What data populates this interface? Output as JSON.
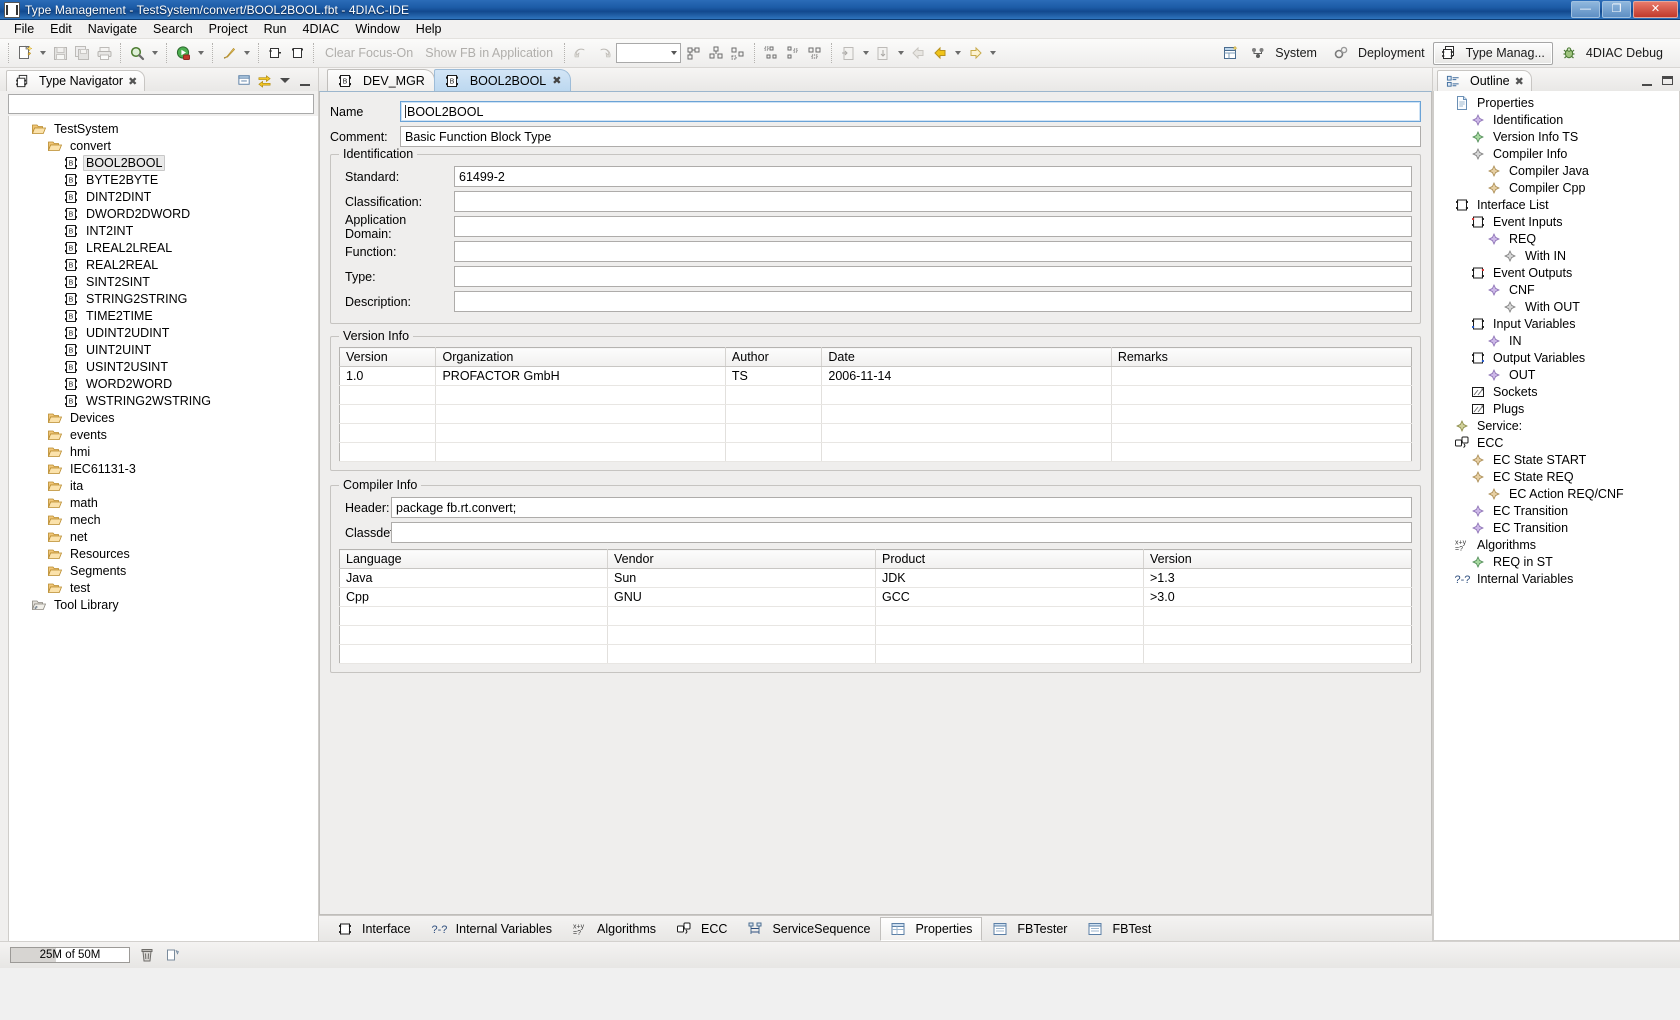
{
  "window": {
    "title": "Type Management - TestSystem/convert/BOOL2BOOL.fbt - 4DIAC-IDE",
    "minimize_label": "—",
    "maximize_label": "❐",
    "close_label": "✕"
  },
  "menubar": {
    "items": [
      "File",
      "Edit",
      "Navigate",
      "Search",
      "Project",
      "Run",
      "4DIAC",
      "Window",
      "Help"
    ]
  },
  "toolbar": {
    "clear_focus_label": "Clear Focus-On",
    "show_fb_label": "Show FB in Application",
    "combo_value": "",
    "perspectives": [
      {
        "label": "System",
        "icon": "system-icon",
        "active": false
      },
      {
        "label": "Deployment",
        "icon": "deployment-icon",
        "active": false
      },
      {
        "label": "Type Manag...",
        "icon": "type-management-icon",
        "active": true
      },
      {
        "label": "4DIAC Debug",
        "icon": "debug-icon",
        "active": false
      }
    ]
  },
  "navigator": {
    "tab_label": "Type Navigator",
    "close_icon": "close-icon",
    "tools": [
      "link-with-editor-icon",
      "synchronize-icon",
      "view-menu-icon",
      "minimize-icon"
    ],
    "filter_value": "",
    "tree": [
      {
        "label": "TestSystem",
        "icon": "folder-open-icon",
        "indent": 1,
        "selected": false
      },
      {
        "label": "convert",
        "icon": "folder-open-icon",
        "indent": 2,
        "selected": false
      },
      {
        "label": "BOOL2BOOL",
        "icon": "fb-type-icon",
        "indent": 3,
        "selected": true
      },
      {
        "label": "BYTE2BYTE",
        "icon": "fb-type-icon",
        "indent": 3,
        "selected": false
      },
      {
        "label": "DINT2DINT",
        "icon": "fb-type-icon",
        "indent": 3,
        "selected": false
      },
      {
        "label": "DWORD2DWORD",
        "icon": "fb-type-icon",
        "indent": 3,
        "selected": false
      },
      {
        "label": "INT2INT",
        "icon": "fb-type-icon",
        "indent": 3,
        "selected": false
      },
      {
        "label": "LREAL2LREAL",
        "icon": "fb-type-icon",
        "indent": 3,
        "selected": false
      },
      {
        "label": "REAL2REAL",
        "icon": "fb-type-icon",
        "indent": 3,
        "selected": false
      },
      {
        "label": "SINT2SINT",
        "icon": "fb-type-icon",
        "indent": 3,
        "selected": false
      },
      {
        "label": "STRING2STRING",
        "icon": "fb-type-icon",
        "indent": 3,
        "selected": false
      },
      {
        "label": "TIME2TIME",
        "icon": "fb-type-icon",
        "indent": 3,
        "selected": false
      },
      {
        "label": "UDINT2UDINT",
        "icon": "fb-type-icon",
        "indent": 3,
        "selected": false
      },
      {
        "label": "UINT2UINT",
        "icon": "fb-type-icon",
        "indent": 3,
        "selected": false
      },
      {
        "label": "USINT2USINT",
        "icon": "fb-type-icon",
        "indent": 3,
        "selected": false
      },
      {
        "label": "WORD2WORD",
        "icon": "fb-type-icon",
        "indent": 3,
        "selected": false
      },
      {
        "label": "WSTRING2WSTRING",
        "icon": "fb-type-icon",
        "indent": 3,
        "selected": false
      },
      {
        "label": "Devices",
        "icon": "folder-open-icon",
        "indent": 2,
        "selected": false
      },
      {
        "label": "events",
        "icon": "folder-open-icon",
        "indent": 2,
        "selected": false
      },
      {
        "label": "hmi",
        "icon": "folder-open-icon",
        "indent": 2,
        "selected": false
      },
      {
        "label": "IEC61131-3",
        "icon": "folder-open-icon",
        "indent": 2,
        "selected": false
      },
      {
        "label": "ita",
        "icon": "folder-open-icon",
        "indent": 2,
        "selected": false
      },
      {
        "label": "math",
        "icon": "folder-open-icon",
        "indent": 2,
        "selected": false
      },
      {
        "label": "mech",
        "icon": "folder-open-icon",
        "indent": 2,
        "selected": false
      },
      {
        "label": "net",
        "icon": "folder-open-icon",
        "indent": 2,
        "selected": false
      },
      {
        "label": "Resources",
        "icon": "folder-open-icon",
        "indent": 2,
        "selected": false
      },
      {
        "label": "Segments",
        "icon": "folder-open-icon",
        "indent": 2,
        "selected": false
      },
      {
        "label": "test",
        "icon": "folder-open-icon",
        "indent": 2,
        "selected": false
      },
      {
        "label": "Tool Library",
        "icon": "tool-library-icon",
        "indent": 1,
        "selected": false
      }
    ]
  },
  "editor": {
    "tabs": [
      {
        "label": "DEV_MGR",
        "icon": "fb-type-icon",
        "active": false,
        "closable": false
      },
      {
        "label": "BOOL2BOOL",
        "icon": "fb-type-icon",
        "active": true,
        "closable": true
      }
    ],
    "name_label": "Name",
    "name_value": "BOOL2BOOL",
    "comment_label": "Comment:",
    "comment_value": "Basic Function Block Type",
    "identification": {
      "title": "Identification",
      "fields": [
        {
          "label": "Standard:",
          "value": "61499-2"
        },
        {
          "label": "Classification:",
          "value": ""
        },
        {
          "label": "Application Domain:",
          "value": ""
        },
        {
          "label": "Function:",
          "value": ""
        },
        {
          "label": "Type:",
          "value": ""
        },
        {
          "label": "Description:",
          "value": ""
        }
      ]
    },
    "version_info": {
      "title": "Version Info",
      "columns": [
        "Version",
        "Organization",
        "Author",
        "Date",
        "Remarks"
      ],
      "rows": [
        [
          "1.0",
          "PROFACTOR GmbH",
          "TS",
          "2006-11-14",
          ""
        ],
        [
          "",
          "",
          "",
          "",
          ""
        ],
        [
          "",
          "",
          "",
          "",
          ""
        ],
        [
          "",
          "",
          "",
          "",
          ""
        ],
        [
          "",
          "",
          "",
          "",
          ""
        ]
      ]
    },
    "compiler_info": {
      "title": "Compiler Info",
      "header_label": "Header:",
      "header_value": "package fb.rt.convert;",
      "classdef_label": "Classdef:",
      "classdef_value": "",
      "columns": [
        "Language",
        "Vendor",
        "Product",
        "Version"
      ],
      "rows": [
        [
          "Java",
          "Sun",
          "JDK",
          ">1.3"
        ],
        [
          "Cpp",
          "GNU",
          "GCC",
          ">3.0"
        ],
        [
          "",
          "",
          "",
          ""
        ],
        [
          "",
          "",
          "",
          ""
        ],
        [
          "",
          "",
          "",
          ""
        ]
      ]
    },
    "bottom_tabs": [
      {
        "label": "Interface",
        "icon": "interface-icon",
        "active": false
      },
      {
        "label": "Internal Variables",
        "icon": "internal-variables-icon",
        "active": false
      },
      {
        "label": "Algorithms",
        "icon": "algorithms-icon",
        "active": false
      },
      {
        "label": "ECC",
        "icon": "ecc-icon",
        "active": false
      },
      {
        "label": "ServiceSequence",
        "icon": "service-sequence-icon",
        "active": false
      },
      {
        "label": "Properties",
        "icon": "properties-icon",
        "active": true
      },
      {
        "label": "FBTester",
        "icon": "fbtester-icon",
        "active": false
      },
      {
        "label": "FBTest",
        "icon": "fbtest-icon",
        "active": false
      }
    ]
  },
  "outline": {
    "tab_label": "Outline",
    "close_icon": "close-icon",
    "tree": [
      {
        "label": "Properties",
        "icon": "document-icon",
        "indent": 1
      },
      {
        "label": "Identification",
        "icon": "diamond-purple-icon",
        "indent": 2
      },
      {
        "label": "Version Info TS",
        "icon": "diamond-green-icon",
        "indent": 2
      },
      {
        "label": "Compiler Info",
        "icon": "diamond-grey-icon",
        "indent": 2
      },
      {
        "label": "Compiler Java",
        "icon": "diamond-tan-icon",
        "indent": 3
      },
      {
        "label": "Compiler Cpp",
        "icon": "diamond-tan-icon",
        "indent": 3
      },
      {
        "label": "Interface List",
        "icon": "interface-icon",
        "indent": 1
      },
      {
        "label": "Event Inputs",
        "icon": "event-input-icon",
        "indent": 2
      },
      {
        "label": "REQ",
        "icon": "diamond-purple-icon",
        "indent": 3
      },
      {
        "label": "With IN",
        "icon": "diamond-grey-icon",
        "indent": 4
      },
      {
        "label": "Event Outputs",
        "icon": "event-output-icon",
        "indent": 2
      },
      {
        "label": "CNF",
        "icon": "diamond-purple-icon",
        "indent": 3
      },
      {
        "label": "With OUT",
        "icon": "diamond-grey-icon",
        "indent": 4
      },
      {
        "label": "Input Variables",
        "icon": "input-variable-icon",
        "indent": 2
      },
      {
        "label": "IN",
        "icon": "diamond-purple-icon",
        "indent": 3
      },
      {
        "label": "Output Variables",
        "icon": "output-variable-icon",
        "indent": 2
      },
      {
        "label": "OUT",
        "icon": "diamond-purple-icon",
        "indent": 3
      },
      {
        "label": "Sockets",
        "icon": "socket-icon",
        "indent": 2
      },
      {
        "label": "Plugs",
        "icon": "plug-icon",
        "indent": 2
      },
      {
        "label": "Service:",
        "icon": "diamond-olive-icon",
        "indent": 1
      },
      {
        "label": "ECC",
        "icon": "ecc-icon",
        "indent": 1
      },
      {
        "label": "EC State START",
        "icon": "diamond-tan-icon",
        "indent": 2
      },
      {
        "label": "EC State REQ",
        "icon": "diamond-tan-icon",
        "indent": 2
      },
      {
        "label": "EC Action REQ/CNF",
        "icon": "diamond-tan-icon",
        "indent": 3
      },
      {
        "label": "EC Transition",
        "icon": "diamond-purple-icon",
        "indent": 2
      },
      {
        "label": "EC Transition",
        "icon": "diamond-purple-icon",
        "indent": 2
      },
      {
        "label": "Algorithms",
        "icon": "algorithms-icon",
        "indent": 1
      },
      {
        "label": "REQ in ST",
        "icon": "diamond-green-icon",
        "indent": 2
      },
      {
        "label": "Internal Variables",
        "icon": "internal-variables-icon",
        "indent": 1
      }
    ]
  },
  "statusbar": {
    "heap_text": "25M of 50M",
    "heap_used_percent": 38,
    "trash_icon": "trash-icon",
    "second_icon": "tasks-icon"
  }
}
